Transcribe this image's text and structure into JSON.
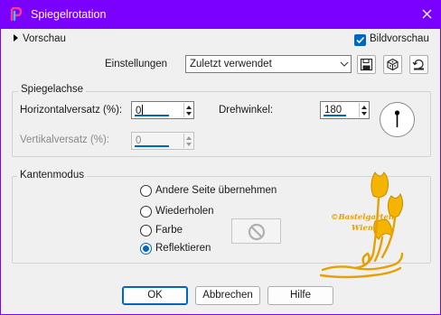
{
  "window": {
    "title": "Spiegelrotation"
  },
  "top": {
    "preview_label": "Vorschau",
    "bild_preview_label": "Bildvorschau",
    "settings_label": "Einstellungen",
    "settings_value": "Zuletzt verwendet"
  },
  "mirror_axis": {
    "title": "Spiegelachse",
    "h_offset_label": "Horizontalversatz (%):",
    "h_offset_value": "0",
    "v_offset_label": "Vertikalversatz (%):",
    "v_offset_value": "0",
    "angle_label": "Drehwinkel:",
    "angle_value": "180"
  },
  "edge_mode": {
    "title": "Kantenmodus",
    "options": [
      "Andere Seite übernehmen",
      "Wiederholen",
      "Farbe",
      "Reflektieren"
    ],
    "selected": "Reflektieren"
  },
  "watermark": {
    "line1": "©Bastelgarten",
    "line2": "Wien"
  },
  "buttons": {
    "ok": "OK",
    "cancel": "Abbrechen",
    "help": "Hilfe"
  },
  "colors": {
    "accent": "#7a00ff",
    "focus_blue": "#0067c0",
    "watermark_gold": "#e8a000"
  }
}
